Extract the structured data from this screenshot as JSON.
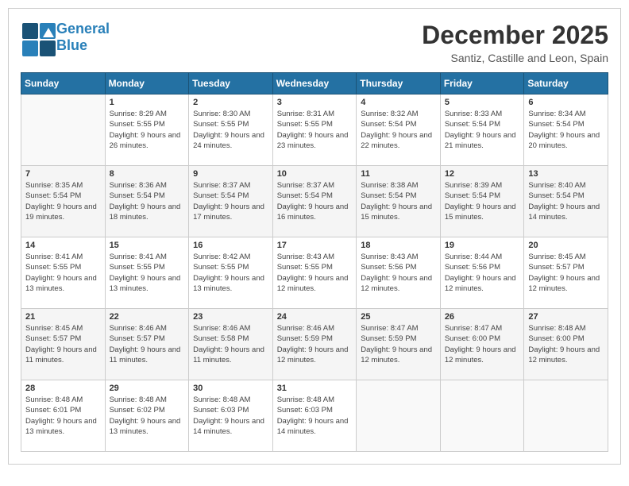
{
  "logo": {
    "line1": "General",
    "line2": "Blue"
  },
  "title": "December 2025",
  "subtitle": "Santiz, Castille and Leon, Spain",
  "header": {
    "days": [
      "Sunday",
      "Monday",
      "Tuesday",
      "Wednesday",
      "Thursday",
      "Friday",
      "Saturday"
    ]
  },
  "weeks": [
    {
      "cells": [
        {
          "empty": true
        },
        {
          "day": "1",
          "sunrise": "8:29 AM",
          "sunset": "5:55 PM",
          "daylight": "9 hours and 26 minutes."
        },
        {
          "day": "2",
          "sunrise": "8:30 AM",
          "sunset": "5:55 PM",
          "daylight": "9 hours and 24 minutes."
        },
        {
          "day": "3",
          "sunrise": "8:31 AM",
          "sunset": "5:55 PM",
          "daylight": "9 hours and 23 minutes."
        },
        {
          "day": "4",
          "sunrise": "8:32 AM",
          "sunset": "5:54 PM",
          "daylight": "9 hours and 22 minutes."
        },
        {
          "day": "5",
          "sunrise": "8:33 AM",
          "sunset": "5:54 PM",
          "daylight": "9 hours and 21 minutes."
        },
        {
          "day": "6",
          "sunrise": "8:34 AM",
          "sunset": "5:54 PM",
          "daylight": "9 hours and 20 minutes."
        }
      ]
    },
    {
      "cells": [
        {
          "day": "7",
          "sunrise": "8:35 AM",
          "sunset": "5:54 PM",
          "daylight": "9 hours and 19 minutes."
        },
        {
          "day": "8",
          "sunrise": "8:36 AM",
          "sunset": "5:54 PM",
          "daylight": "9 hours and 18 minutes."
        },
        {
          "day": "9",
          "sunrise": "8:37 AM",
          "sunset": "5:54 PM",
          "daylight": "9 hours and 17 minutes."
        },
        {
          "day": "10",
          "sunrise": "8:37 AM",
          "sunset": "5:54 PM",
          "daylight": "9 hours and 16 minutes."
        },
        {
          "day": "11",
          "sunrise": "8:38 AM",
          "sunset": "5:54 PM",
          "daylight": "9 hours and 15 minutes."
        },
        {
          "day": "12",
          "sunrise": "8:39 AM",
          "sunset": "5:54 PM",
          "daylight": "9 hours and 15 minutes."
        },
        {
          "day": "13",
          "sunrise": "8:40 AM",
          "sunset": "5:54 PM",
          "daylight": "9 hours and 14 minutes."
        }
      ]
    },
    {
      "cells": [
        {
          "day": "14",
          "sunrise": "8:41 AM",
          "sunset": "5:55 PM",
          "daylight": "9 hours and 13 minutes."
        },
        {
          "day": "15",
          "sunrise": "8:41 AM",
          "sunset": "5:55 PM",
          "daylight": "9 hours and 13 minutes."
        },
        {
          "day": "16",
          "sunrise": "8:42 AM",
          "sunset": "5:55 PM",
          "daylight": "9 hours and 13 minutes."
        },
        {
          "day": "17",
          "sunrise": "8:43 AM",
          "sunset": "5:55 PM",
          "daylight": "9 hours and 12 minutes."
        },
        {
          "day": "18",
          "sunrise": "8:43 AM",
          "sunset": "5:56 PM",
          "daylight": "9 hours and 12 minutes."
        },
        {
          "day": "19",
          "sunrise": "8:44 AM",
          "sunset": "5:56 PM",
          "daylight": "9 hours and 12 minutes."
        },
        {
          "day": "20",
          "sunrise": "8:45 AM",
          "sunset": "5:57 PM",
          "daylight": "9 hours and 12 minutes."
        }
      ]
    },
    {
      "cells": [
        {
          "day": "21",
          "sunrise": "8:45 AM",
          "sunset": "5:57 PM",
          "daylight": "9 hours and 11 minutes."
        },
        {
          "day": "22",
          "sunrise": "8:46 AM",
          "sunset": "5:57 PM",
          "daylight": "9 hours and 11 minutes."
        },
        {
          "day": "23",
          "sunrise": "8:46 AM",
          "sunset": "5:58 PM",
          "daylight": "9 hours and 11 minutes."
        },
        {
          "day": "24",
          "sunrise": "8:46 AM",
          "sunset": "5:59 PM",
          "daylight": "9 hours and 12 minutes."
        },
        {
          "day": "25",
          "sunrise": "8:47 AM",
          "sunset": "5:59 PM",
          "daylight": "9 hours and 12 minutes."
        },
        {
          "day": "26",
          "sunrise": "8:47 AM",
          "sunset": "6:00 PM",
          "daylight": "9 hours and 12 minutes."
        },
        {
          "day": "27",
          "sunrise": "8:48 AM",
          "sunset": "6:00 PM",
          "daylight": "9 hours and 12 minutes."
        }
      ]
    },
    {
      "cells": [
        {
          "day": "28",
          "sunrise": "8:48 AM",
          "sunset": "6:01 PM",
          "daylight": "9 hours and 13 minutes."
        },
        {
          "day": "29",
          "sunrise": "8:48 AM",
          "sunset": "6:02 PM",
          "daylight": "9 hours and 13 minutes."
        },
        {
          "day": "30",
          "sunrise": "8:48 AM",
          "sunset": "6:03 PM",
          "daylight": "9 hours and 14 minutes."
        },
        {
          "day": "31",
          "sunrise": "8:48 AM",
          "sunset": "6:03 PM",
          "daylight": "9 hours and 14 minutes."
        },
        {
          "empty": true
        },
        {
          "empty": true
        },
        {
          "empty": true
        }
      ]
    }
  ],
  "labels": {
    "sunrise": "Sunrise:",
    "sunset": "Sunset:",
    "daylight": "Daylight:"
  }
}
